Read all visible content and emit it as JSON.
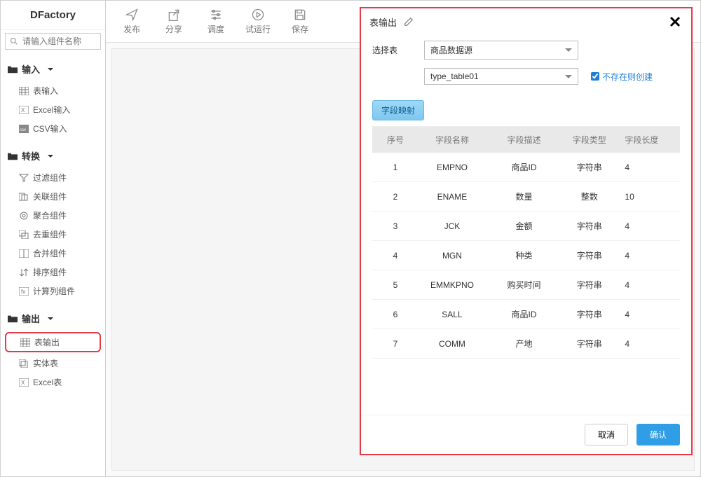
{
  "app": {
    "title": "DFactory"
  },
  "search": {
    "placeholder": "请输入组件名称"
  },
  "nav": {
    "groups": [
      {
        "label": "输入",
        "items": [
          {
            "label": "表输入"
          },
          {
            "label": "Excel输入"
          },
          {
            "label": "CSV输入"
          }
        ]
      },
      {
        "label": "转换",
        "items": [
          {
            "label": "过滤组件"
          },
          {
            "label": "关联组件"
          },
          {
            "label": "聚合组件"
          },
          {
            "label": "去重组件"
          },
          {
            "label": "合并组件"
          },
          {
            "label": "排序组件"
          },
          {
            "label": "计算列组件"
          }
        ]
      },
      {
        "label": "输出",
        "items": [
          {
            "label": "表输出"
          },
          {
            "label": "实体表"
          },
          {
            "label": "Excel表"
          }
        ]
      }
    ]
  },
  "toolbar": {
    "items": [
      {
        "label": "发布"
      },
      {
        "label": "分享"
      },
      {
        "label": "调度"
      },
      {
        "label": "试运行"
      },
      {
        "label": "保存"
      }
    ]
  },
  "dialog": {
    "title": "表输出",
    "select_label": "选择表",
    "datasource": "商品数据源",
    "table": "type_table01",
    "create_if_missing": "不存在则创建",
    "map_button": "字段映射",
    "columns": {
      "seq": "序号",
      "name": "字段名称",
      "desc": "字段描述",
      "type": "字段类型",
      "len": "字段长度"
    },
    "rows": [
      {
        "seq": "1",
        "name": "EMPNO",
        "desc": "商品ID",
        "type": "字符串",
        "len": "4"
      },
      {
        "seq": "2",
        "name": "ENAME",
        "desc": "数量",
        "type": "整数",
        "len": "10"
      },
      {
        "seq": "3",
        "name": "JCK",
        "desc": "金额",
        "type": "字符串",
        "len": "4"
      },
      {
        "seq": "4",
        "name": "MGN",
        "desc": "种类",
        "type": "字符串",
        "len": "4"
      },
      {
        "seq": "5",
        "name": "EMMKPNO",
        "desc": "购买时间",
        "type": "字符串",
        "len": "4"
      },
      {
        "seq": "6",
        "name": "SALL",
        "desc": "商品ID",
        "type": "字符串",
        "len": "4"
      },
      {
        "seq": "7",
        "name": "COMM",
        "desc": "产地",
        "type": "字符串",
        "len": "4"
      }
    ],
    "cancel": "取消",
    "confirm": "确认"
  }
}
